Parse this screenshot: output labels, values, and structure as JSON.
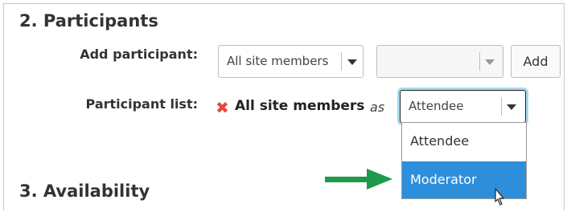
{
  "sections": {
    "participants_title": "2. Participants",
    "availability_title": "3. Availability"
  },
  "add_participant": {
    "label": "Add participant:",
    "type_select_value": "All site members",
    "member_select_value": "",
    "add_button": "Add"
  },
  "participant_list": {
    "label": "Participant list:",
    "remove_icon": "close-icon",
    "entry_name": "All site members",
    "as_text": "as",
    "role_select_value": "Attendee",
    "role_options": [
      "Attendee",
      "Moderator"
    ],
    "highlighted_option": "Moderator"
  },
  "colors": {
    "highlight": "#2d8fdc",
    "remove_icon": "#e8483b",
    "arrow": "#1e9b4a",
    "focus_ring": "#a9d9ef"
  }
}
